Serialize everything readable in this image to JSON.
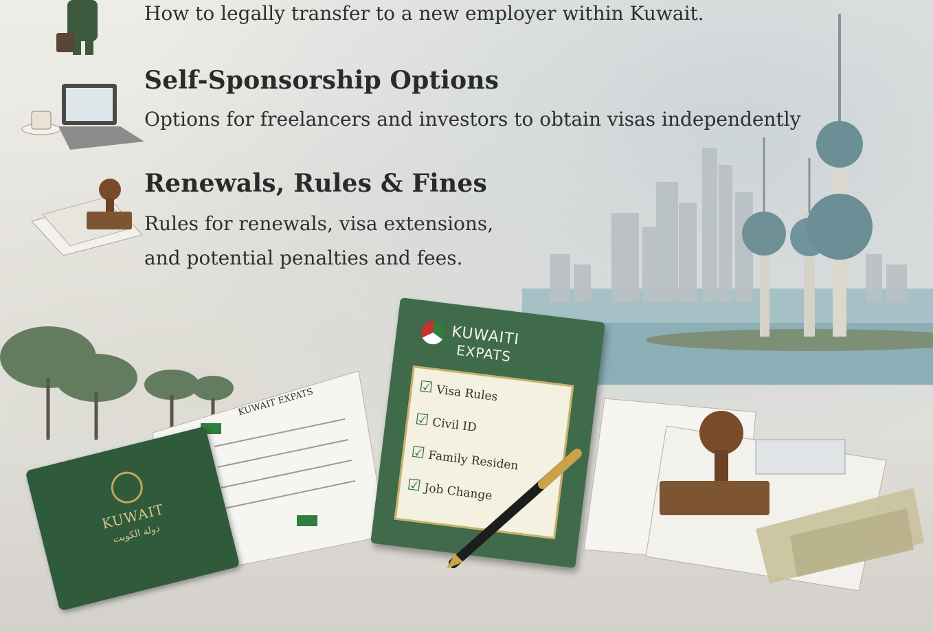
{
  "items": [
    {
      "icon": "businessman-icon",
      "description": "How to legally transfer to a new employer within Kuwait."
    },
    {
      "icon": "laptop-icon",
      "title": "Self-Sponsorship Options",
      "description": "Options for freelancers and investors to obtain visas independently"
    },
    {
      "icon": "stamp-icon",
      "title": "Renewals, Rules & Fines",
      "description_lines": [
        "Rules for renewals, visa extensions,",
        "and potential penalties and fees."
      ]
    }
  ],
  "illustration": {
    "book": {
      "title_lines": [
        "KUWAITI",
        "EXPATS"
      ],
      "checklist": [
        "Visa Rules",
        "Civil ID",
        "Family Residen",
        "Job Change"
      ]
    },
    "passport": {
      "label": "KUWAIT",
      "arabic_label": "دولة الكويت"
    },
    "notebook_header": "KUWAIT EXPATS"
  },
  "colors": {
    "book_green": "#3f6b4a",
    "passport_green": "#2f5a3c",
    "water": "#8fb2b9",
    "towers": "#c9cdc9",
    "text": "#2a2a2a"
  }
}
